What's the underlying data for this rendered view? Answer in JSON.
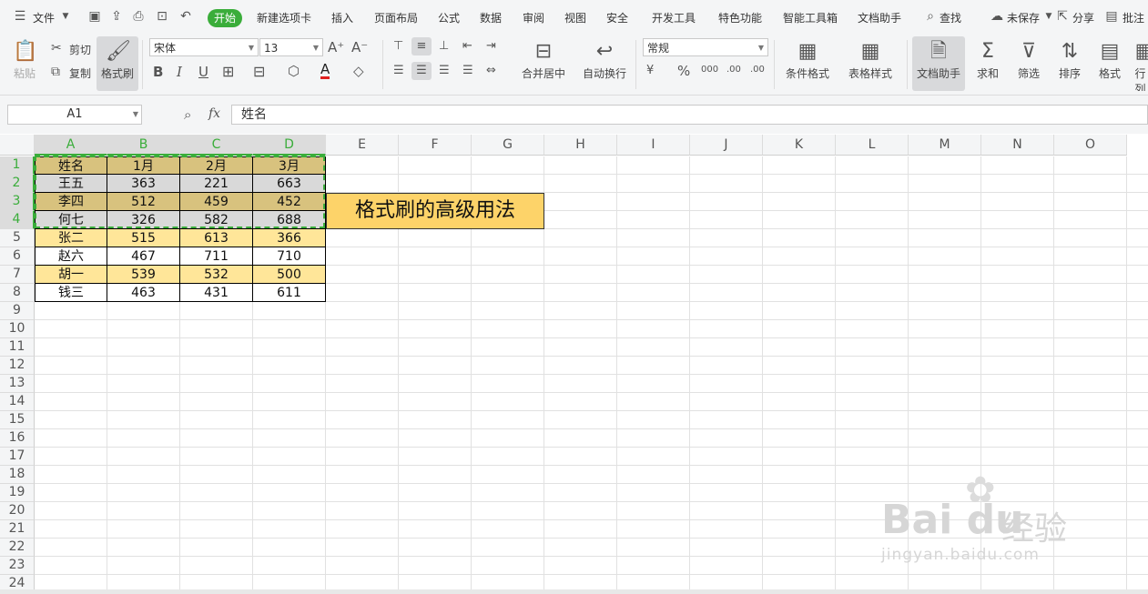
{
  "menu": {
    "file": "文件",
    "tabs": [
      "开始",
      "新建选项卡",
      "插入",
      "页面布局",
      "公式",
      "数据",
      "审阅",
      "视图",
      "安全",
      "开发工具",
      "特色功能",
      "智能工具箱",
      "文档助手"
    ],
    "search": "查找",
    "unsaved": "未保存",
    "share": "分享",
    "comment": "批注"
  },
  "ribbon": {
    "paste": "粘贴",
    "cut": "剪切",
    "copy": "复制",
    "format_painter": "格式刷",
    "font_name": "宋体",
    "font_size": "13",
    "merge_center": "合并居中",
    "wrap_text": "自动换行",
    "number_format": "常规",
    "conditional_format": "条件格式",
    "table_style": "表格样式",
    "doc_assistant": "文档助手",
    "sum": "求和",
    "filter": "筛选",
    "sort": "排序",
    "format": "格式",
    "rows_cols": "行列",
    "percent": "%",
    "thousands": "000",
    "dec_inc": ".00",
    "dec_dec": ".00",
    "currency": "¥"
  },
  "formula_bar": {
    "name_box": "A1",
    "fx": "fx",
    "value": "姓名"
  },
  "columns": [
    "A",
    "B",
    "C",
    "D",
    "E",
    "F",
    "G",
    "H",
    "I",
    "J",
    "K",
    "L",
    "M",
    "N",
    "O"
  ],
  "rows": [
    "1",
    "2",
    "3",
    "4",
    "5",
    "6",
    "7",
    "8",
    "9",
    "10",
    "11",
    "12",
    "13",
    "14",
    "15",
    "16",
    "17",
    "18",
    "19",
    "20",
    "21",
    "22",
    "23",
    "24"
  ],
  "table": {
    "header": [
      "姓名",
      "1月",
      "2月",
      "3月"
    ],
    "data": [
      [
        "王五",
        "363",
        "221",
        "663"
      ],
      [
        "李四",
        "512",
        "459",
        "452"
      ],
      [
        "何七",
        "326",
        "582",
        "688"
      ],
      [
        "张二",
        "515",
        "613",
        "366"
      ],
      [
        "赵六",
        "467",
        "711",
        "710"
      ],
      [
        "胡一",
        "539",
        "532",
        "500"
      ],
      [
        "钱三",
        "463",
        "431",
        "611"
      ]
    ],
    "row_colors": [
      "#d8c27e",
      "#d9d9d9",
      "#d8c27e",
      "#d9d9d9",
      "#ffe699",
      "#ffffff",
      "#ffe699",
      "#ffffff"
    ]
  },
  "banner": "格式刷的高级用法",
  "watermark": {
    "logo": "Bai du",
    "cn": "经验",
    "url": "jingyan.baidu.com"
  },
  "colors": {
    "accent": "#3aad3a",
    "banner_bg": "#fdd369"
  }
}
